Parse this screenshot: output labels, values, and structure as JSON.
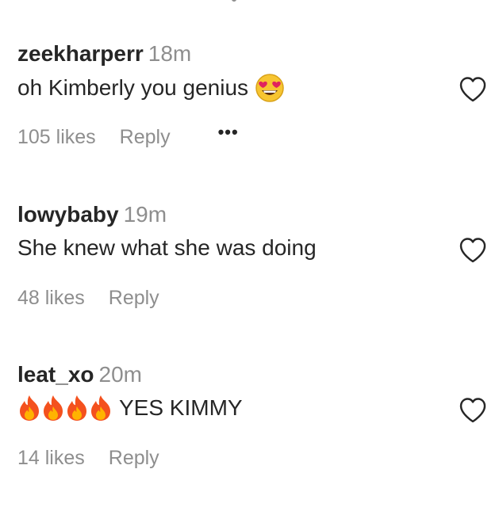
{
  "comments": [
    {
      "username": "zeekharperr",
      "time": "18m",
      "text": "oh Kimberly you genius",
      "emoji_after": "heart-eyes-emoji",
      "likes": "105 likes",
      "reply": "Reply",
      "more": "•••",
      "heart_icon": "heart-outline-icon"
    },
    {
      "username": "lowybaby",
      "time": "19m",
      "text": "She knew what she was doing",
      "likes": "48 likes",
      "reply": "Reply",
      "heart_icon": "heart-outline-icon"
    },
    {
      "username": "leat_xo",
      "time": "20m",
      "emoji_before": [
        "fire-emoji",
        "fire-emoji",
        "fire-emoji",
        "fire-emoji"
      ],
      "text": "YES KIMMY",
      "likes": "14 likes",
      "reply": "Reply",
      "heart_icon": "heart-outline-icon"
    }
  ],
  "colors": {
    "primary_text": "#262626",
    "secondary_text": "#8e8e8e",
    "background": "#ffffff"
  }
}
